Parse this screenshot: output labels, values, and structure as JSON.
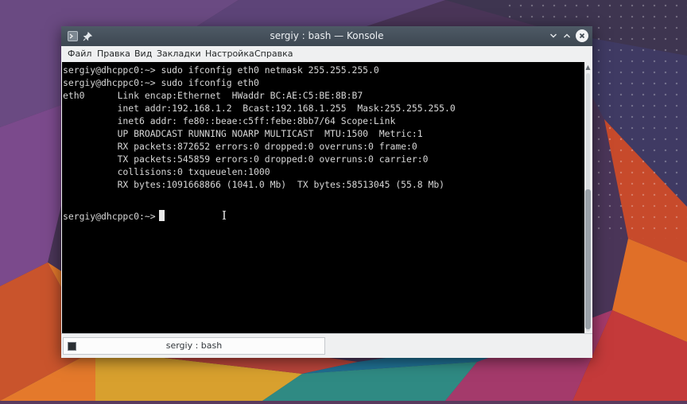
{
  "window": {
    "title": "sergiy : bash — Konsole"
  },
  "menu": [
    "Файл",
    "Правка",
    "Вид",
    "Закладки",
    "Настройка",
    "Справка"
  ],
  "terminal": {
    "lines": [
      "sergiy@dhcppc0:~> sudo ifconfig eth0 netmask 255.255.255.0",
      "sergiy@dhcppc0:~> sudo ifconfig eth0",
      "eth0      Link encap:Ethernet  HWaddr BC:AE:C5:BE:8B:B7",
      "          inet addr:192.168.1.2  Bcast:192.168.1.255  Mask:255.255.255.0",
      "          inet6 addr: fe80::beae:c5ff:febe:8bb7/64 Scope:Link",
      "          UP BROADCAST RUNNING NOARP MULTICAST  MTU:1500  Metric:1",
      "          RX packets:872652 errors:0 dropped:0 overruns:0 frame:0",
      "          TX packets:545859 errors:0 dropped:0 overruns:0 carrier:0",
      "          collisions:0 txqueuelen:1000",
      "          RX bytes:1091668866 (1041.0 Mb)  TX bytes:58513045 (55.8 Mb)",
      "",
      "sergiy@dhcppc0:~> "
    ]
  },
  "tabs": [
    {
      "label": "sergiy : bash"
    }
  ],
  "icons": {
    "app": "terminal-icon",
    "pin": "pin-icon",
    "minimize": "chevron-down-icon",
    "maximize": "chevron-up-icon",
    "close": "close-icon",
    "cursor": "text-cursor-icon"
  },
  "colors": {
    "titlebar": "#3d4751",
    "terminal_bg": "#000000",
    "terminal_fg": "#d7d7d7",
    "chrome": "#eff0f1"
  }
}
